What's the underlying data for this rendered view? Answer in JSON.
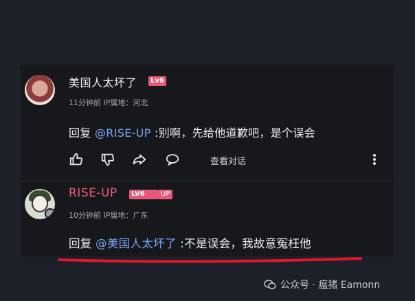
{
  "comments": [
    {
      "username": "美国人太坏了",
      "level_badge": "Lv6",
      "meta": "11分钟前 IP属地：河北",
      "reply_prefix": "回复 ",
      "mention": "@RISE-UP",
      "reply_text": " :别啊，先给他道歉吧，是个误会",
      "actions": {
        "view_conversation": "查看对话"
      }
    },
    {
      "username": "RISE-UP",
      "level_badge": "LV6",
      "extra_badge": "UP",
      "meta": "10分钟前 IP属地：广东",
      "reply_prefix": "回复 ",
      "mention": "@美国人太坏了",
      "reply_text": " :不是误会，我故意冤枉他"
    }
  ],
  "colors": {
    "background": "#1e2029",
    "card": "#17181c",
    "level_badge": "#e9587a",
    "mention": "#7aa6f6",
    "underline": "#e0162b"
  },
  "icons": [
    "like-icon",
    "dislike-icon",
    "share-icon",
    "comment-icon",
    "more-vertical-icon",
    "wechat-icon"
  ],
  "watermark": "公众号 · 瘟猪 Eamonn"
}
